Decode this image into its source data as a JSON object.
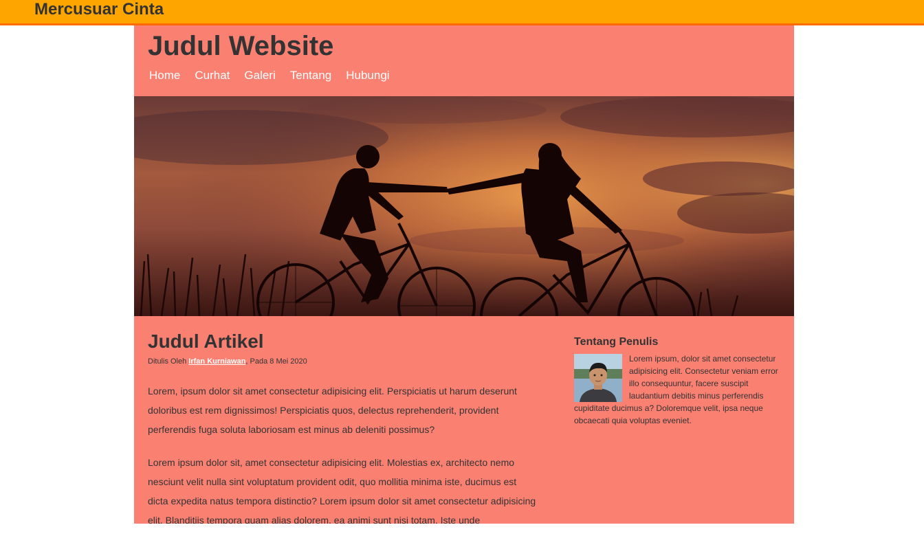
{
  "topbar": {
    "brand": "Mercusuar Cinta"
  },
  "header": {
    "site_title": "Judul Website",
    "nav": [
      {
        "label": "Home"
      },
      {
        "label": "Curhat"
      },
      {
        "label": "Galeri"
      },
      {
        "label": "Tentang"
      },
      {
        "label": "Hubungi"
      }
    ]
  },
  "hero": {
    "description_icon": "couple-bikes-sunset-image"
  },
  "article": {
    "title": "Judul Artikel",
    "meta_prefix": "Ditulis Oleh ",
    "author": "Irfan Kurniawan",
    "meta_suffix": ", Pada 8 Mei 2020",
    "paragraphs": [
      "Lorem, ipsum dolor sit amet consectetur adipisicing elit. Perspiciatis ut harum deserunt doloribus est rem dignissimos! Perspiciatis quos, delectus reprehenderit, provident perferendis fuga soluta laboriosam est minus ab deleniti possimus?",
      "Lorem ipsum dolor sit, amet consectetur adipisicing elit. Molestias ex, architecto nemo nesciunt velit nulla sint voluptatum provident odit, quo mollitia minima iste, ducimus est dicta expedita natus tempora distinctio? Lorem ipsum dolor sit amet consectetur adipisicing elit. Blanditiis tempora quam alias dolorem, ea animi sunt nisi totam. Iste unde"
    ]
  },
  "sidebar": {
    "title": "Tentang Penulis",
    "text": "Lorem ipsum, dolor sit amet consectetur adipisicing elit. Consectetur veniam error illo consequuntur, facere suscipit laudantium debitis minus perferendis cupiditate ducimus a? Doloremque velit, ipsa neque obcaecati quia voluptas eveniet."
  },
  "colors": {
    "topbar": "#ffa500",
    "topbar_border": "#ff6a00",
    "container": "#fa8072",
    "heading_text": "#333333",
    "nav_text": "#ffffff"
  }
}
